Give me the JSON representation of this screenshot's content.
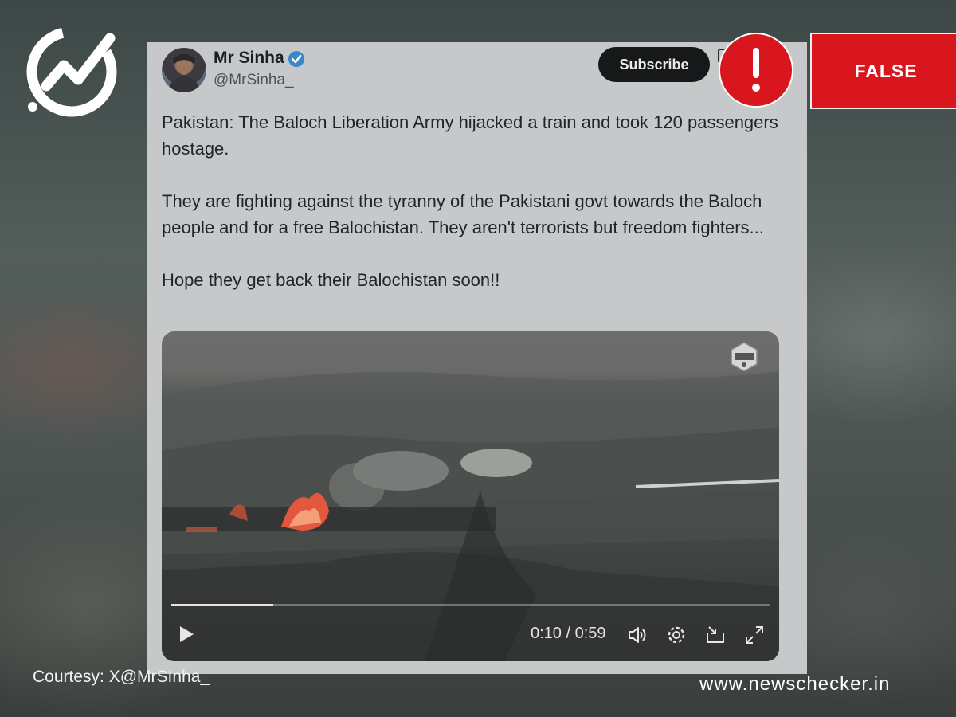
{
  "brand": {
    "logo_icon": "newschecker-check-logo-icon",
    "website": "www.newschecker.in"
  },
  "verdict": {
    "label": "FALSE",
    "color": "#d9151e",
    "icon": "exclamation-icon"
  },
  "credit": "Courtesy: X@MrSInha_",
  "post": {
    "author_name": "Mr Sinha",
    "author_handle": "@MrSinha_",
    "verified_icon": "verified-badge-icon",
    "subscribe_label": "Subscribe",
    "paragraphs": [
      "Pakistan: The Baloch Liberation Army hijacked a train and took 120 passengers hostage.",
      "They are fighting against the tyranny of the Pakistani govt towards the Baloch people and for a free Balochistan. They aren't terrorists but freedom fighters...",
      "Hope they get back their Balochistan soon!!"
    ]
  },
  "video": {
    "watermark": "B.L.A",
    "time_display": "0:10 / 0:59",
    "progress": 0.17,
    "controls": [
      "play-icon",
      "volume-icon",
      "settings-icon",
      "pip-icon",
      "fullscreen-icon"
    ]
  }
}
